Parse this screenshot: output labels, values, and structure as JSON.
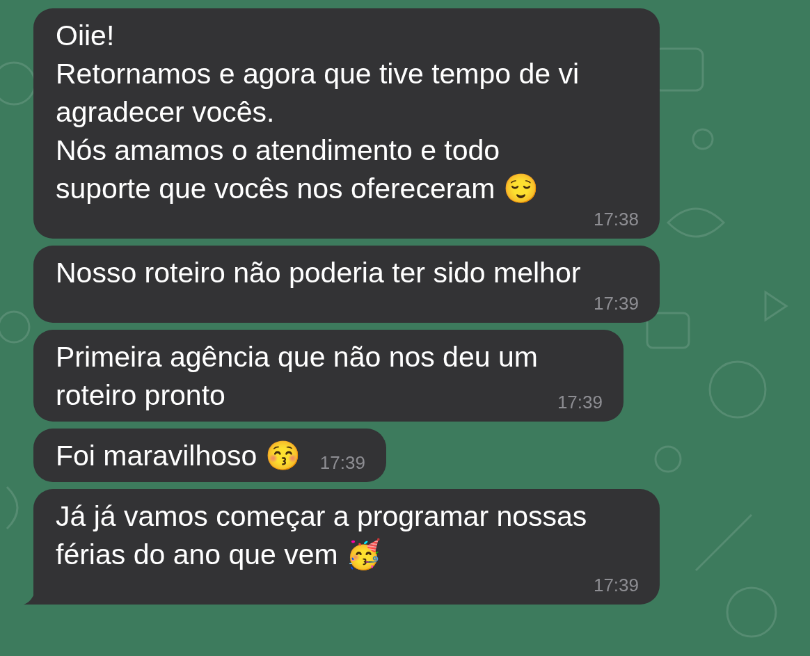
{
  "chat": {
    "messages": [
      {
        "text": "Oiie!\nRetornamos e agora que tive tempo de vi\nagradecer vocês.\nNós amamos o atendimento e todo\nsuporte que vocês nos ofereceram 😌",
        "time": "17:38",
        "tail": false
      },
      {
        "text": "Nosso roteiro não poderia ter sido melhor",
        "time": "17:39",
        "tail": false
      },
      {
        "text": "Primeira agência que não nos deu um\nroteiro pronto",
        "time": "17:39",
        "tail": false
      },
      {
        "text": "Foi maravilhoso 😚",
        "time": "17:39",
        "tail": false
      },
      {
        "text": "Já já vamos começar a programar nossas\nférias do ano que vem 🥳",
        "time": "17:39",
        "tail": true
      }
    ]
  }
}
